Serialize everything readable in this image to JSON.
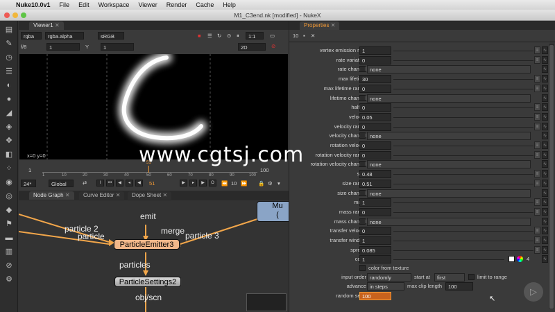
{
  "menubar": {
    "apple": "",
    "app_name": "Nuke10.0v1",
    "items": [
      "File",
      "Edit",
      "Workspace",
      "Viewer",
      "Render",
      "Cache",
      "Help"
    ]
  },
  "window": {
    "title": "M1_C3end.nk [modified] - NukeX"
  },
  "viewer": {
    "tab_label": "Viewer1",
    "channels": "rgba",
    "alpha": "rgba.alpha",
    "colorspace": "sRGB",
    "zoom": "1:1",
    "fstop": "f/8",
    "gain": "1",
    "gamma_label": "Y",
    "gamma": "1",
    "view_mode": "2D",
    "coords": "x=0 y=0",
    "timeline": {
      "start": "1",
      "end": "100",
      "current": "51",
      "ticks": [
        "1",
        "10",
        "20",
        "30",
        "40",
        "50",
        "60",
        "70",
        "80",
        "90",
        "100"
      ],
      "fps": "24*",
      "scope": "Global",
      "frame_field": "51",
      "increment": "10"
    }
  },
  "nodegraph": {
    "tabs": [
      "Node Graph",
      "Curve Editor",
      "Dope Sheet"
    ],
    "nodes": {
      "emitter": "ParticleEmitter3",
      "settings": "ParticleSettings2",
      "merge_partial": "Mu",
      "merge_partial2": "("
    },
    "labels": {
      "emit": "emit",
      "merge": "merge",
      "particle2": "particle 2",
      "particle": "particle",
      "particle3": "particle 3",
      "particles": "particles",
      "objscn": "obj/scn"
    }
  },
  "properties": {
    "tab_label": "Properties",
    "count": "10",
    "rows": [
      {
        "label": "vertex emission rate",
        "value": "1",
        "type": "num"
      },
      {
        "label": "rate variation",
        "value": "0",
        "type": "num"
      },
      {
        "label": "rate channel",
        "value": "none",
        "type": "dd"
      },
      {
        "label": "max lifetime",
        "value": "30",
        "type": "num"
      },
      {
        "label": "max lifetime range",
        "value": "0",
        "type": "num"
      },
      {
        "label": "lifetime channel",
        "value": "none",
        "type": "dd"
      },
      {
        "label": "halflife",
        "value": "0",
        "type": "num"
      },
      {
        "label": "velocity",
        "value": "0.05",
        "type": "num"
      },
      {
        "label": "velocity range",
        "value": "0",
        "type": "num"
      },
      {
        "label": "velocity channel",
        "value": "none",
        "type": "dd"
      },
      {
        "label": "rotation velocity",
        "value": "0",
        "type": "num"
      },
      {
        "label": "rotation velocity range",
        "value": "0",
        "type": "num"
      },
      {
        "label": "rotation velocity channel",
        "value": "none",
        "type": "dd"
      },
      {
        "label": "size",
        "value": "0.48",
        "type": "num"
      },
      {
        "label": "size range",
        "value": "0.51",
        "type": "num"
      },
      {
        "label": "size channel",
        "value": "none",
        "type": "dd"
      },
      {
        "label": "mass",
        "value": "1",
        "type": "num"
      },
      {
        "label": "mass range",
        "value": "0",
        "type": "num"
      },
      {
        "label": "mass channel",
        "value": "none",
        "type": "dd"
      },
      {
        "label": "transfer velocity",
        "value": "0",
        "type": "num"
      },
      {
        "label": "transfer window",
        "value": "1",
        "type": "num"
      },
      {
        "label": "spread",
        "value": "0.085",
        "type": "num"
      },
      {
        "label": "color",
        "value": "1",
        "type": "color"
      }
    ],
    "color_from_texture": "color from texture",
    "input_order_label": "input order",
    "input_order": "randomly",
    "start_at_label": "start at",
    "start_at": "first",
    "limit_to_range": "limit to range",
    "advance_label": "advance",
    "advance": "in steps",
    "max_clip_length_label": "max clip length",
    "max_clip_length": "100",
    "random_seed_label": "random seed",
    "random_seed": "100",
    "color_channels": "4"
  },
  "watermark": "www.cgtsj.com",
  "colors": {
    "accent": "#f39a36",
    "node_emitter": "#f2b88a",
    "node_settings": "#bfbfbf",
    "edge": "#f2a64a"
  }
}
